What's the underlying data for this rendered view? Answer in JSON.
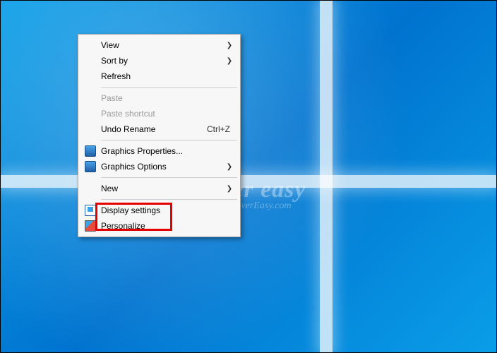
{
  "watermark": {
    "line1": "driver easy",
    "line2": "www.DriverEasy.com"
  },
  "menu": {
    "view": {
      "label": "View",
      "has_submenu": true
    },
    "sort_by": {
      "label": "Sort by",
      "has_submenu": true
    },
    "refresh": {
      "label": "Refresh"
    },
    "paste": {
      "label": "Paste"
    },
    "paste_shortcut": {
      "label": "Paste shortcut"
    },
    "undo_rename": {
      "label": "Undo Rename",
      "shortcut": "Ctrl+Z"
    },
    "gfx_props": {
      "label": "Graphics Properties..."
    },
    "gfx_opts": {
      "label": "Graphics Options",
      "has_submenu": true
    },
    "new": {
      "label": "New",
      "has_submenu": true
    },
    "display": {
      "label": "Display settings"
    },
    "personalize": {
      "label": "Personalize"
    }
  },
  "highlight_target": "display"
}
